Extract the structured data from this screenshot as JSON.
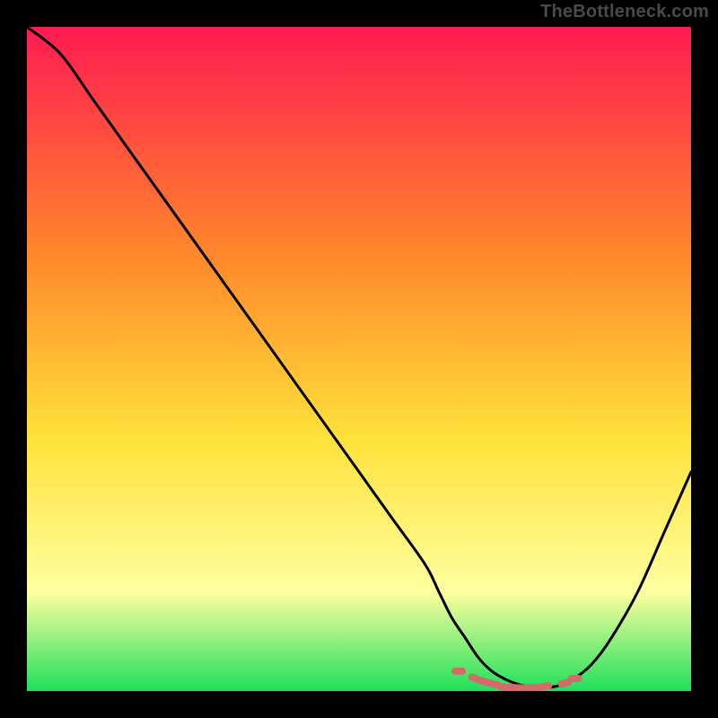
{
  "watermark": "TheBottleneck.com",
  "colors": {
    "bg": "#000000",
    "grad_top": "#ff1a52",
    "grad_mid1": "#ff8a2a",
    "grad_mid2": "#ffe23a",
    "grad_mid3": "#ffffa0",
    "grad_bottom": "#1fe05a",
    "curve": "#000000",
    "marker_fill": "#d46a6a",
    "marker_stroke": "#c95858"
  },
  "chart_data": {
    "type": "line",
    "title": "",
    "xlabel": "",
    "ylabel": "",
    "xlim": [
      0,
      100
    ],
    "ylim": [
      0,
      100
    ],
    "series": [
      {
        "name": "bottleneck-curve",
        "x": [
          0,
          5,
          10,
          15,
          20,
          25,
          30,
          35,
          40,
          45,
          50,
          55,
          60,
          62,
          64,
          66,
          68,
          70,
          72,
          74,
          76,
          78,
          80,
          82,
          85,
          88,
          92,
          96,
          100
        ],
        "y": [
          100,
          96,
          89,
          82,
          75,
          68,
          61,
          54,
          47,
          40,
          33,
          26,
          19,
          15,
          11,
          8,
          5,
          3,
          1.8,
          1.0,
          0.6,
          0.5,
          0.8,
          1.6,
          4,
          8,
          15,
          24,
          33
        ]
      }
    ],
    "markers": {
      "name": "optimal-range",
      "x": [
        65.0,
        67.5,
        69.0,
        70.5,
        72.0,
        73.0,
        74.0,
        75.5,
        77.0,
        78.0,
        81.0,
        82.5
      ],
      "y": [
        3.0,
        1.9,
        1.4,
        1.0,
        0.55,
        0.52,
        0.48,
        0.46,
        0.55,
        0.7,
        1.2,
        1.9
      ]
    }
  }
}
